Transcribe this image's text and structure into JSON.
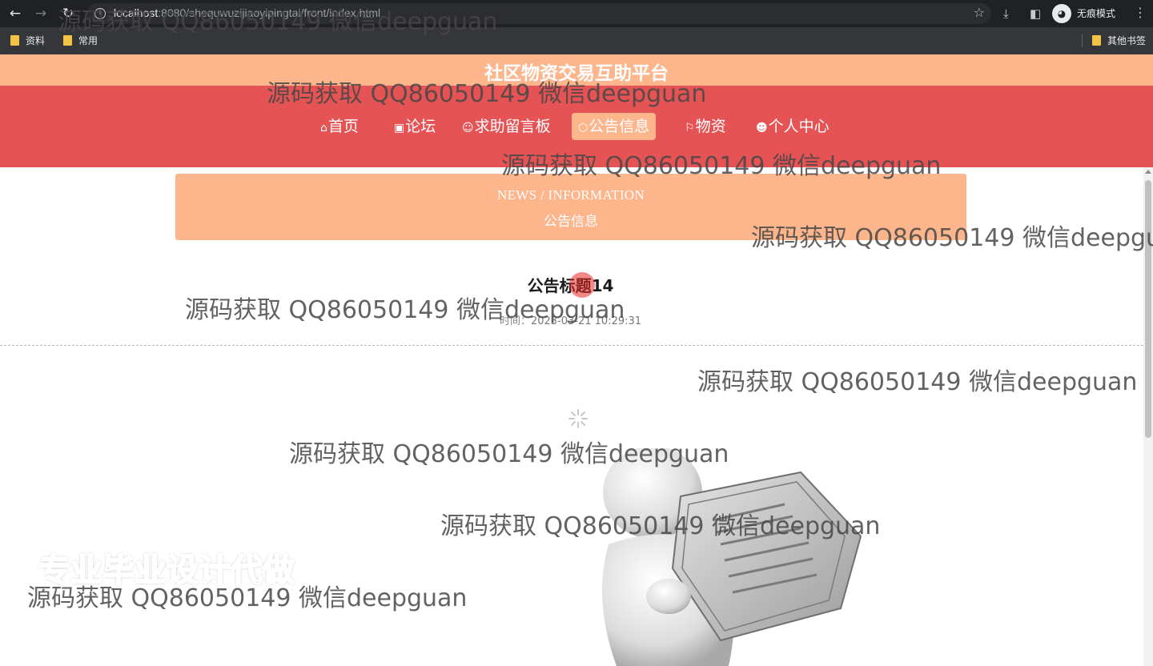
{
  "browser": {
    "url_host": "localhost",
    "url_path": ":8080/shequwuzijiaoyipingtai/front/index.html",
    "incognito_label": "无痕模式",
    "bookmarks": [
      "资料",
      "常用"
    ],
    "other_bookmarks": "其他书签"
  },
  "site": {
    "title": "社区物资交易互助平台",
    "nav": [
      {
        "icon": "home-icon",
        "label": "首页"
      },
      {
        "icon": "gift-icon",
        "label": "论坛"
      },
      {
        "icon": "smile-icon",
        "label": "求助留言板"
      },
      {
        "icon": "cube-icon",
        "label": "公告信息"
      },
      {
        "icon": "flag-icon",
        "label": "物资"
      },
      {
        "icon": "user-icon",
        "label": "个人中心"
      }
    ],
    "active_nav": "公告信息",
    "accent_color": "#fdb58c",
    "nav_color": "#e65355"
  },
  "section": {
    "title_en": "NEWS / INFORMATION",
    "title_cn": "公告信息"
  },
  "article": {
    "title": "公告标题14",
    "time_label": "时间：",
    "time_value": "2023-03-21 10:29:31"
  },
  "overlays": {
    "watermark": "源码获取 QQ86050149 微信deepguan",
    "promo": "专业毕业设计代做"
  }
}
